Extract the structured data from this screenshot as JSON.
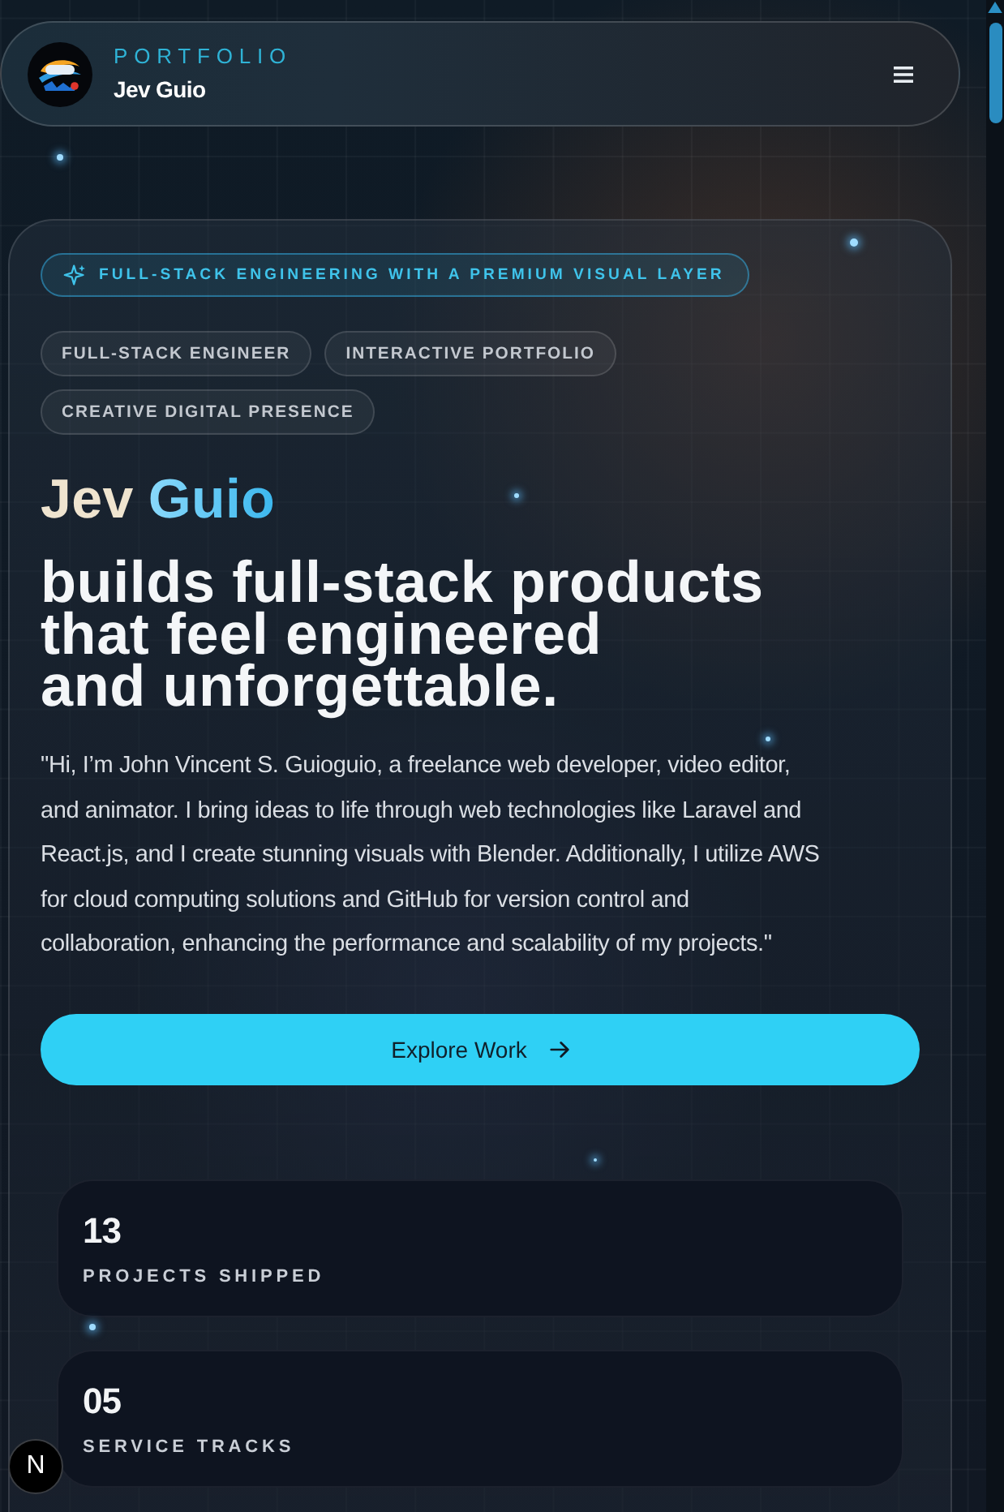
{
  "header": {
    "eyebrow": "PORTFOLIO",
    "title": "Jev Guio"
  },
  "hero": {
    "badge": "FULL-STACK ENGINEERING WITH A PREMIUM VISUAL LAYER",
    "chips": [
      "FULL-STACK ENGINEER",
      "INTERACTIVE PORTFOLIO",
      "CREATIVE DIGITAL PRESENCE"
    ],
    "name": [
      {
        "text": "Jev",
        "accent": false
      },
      {
        "text": "Guio",
        "accent": true
      }
    ],
    "headline": [
      "builds full-stack products",
      "that feel engineered",
      "and unforgettable."
    ],
    "intro": "\"Hi, I’m John Vincent S. Guioguio, a freelance web developer, video editor, and animator. I bring ideas to life through web technologies like Laravel and React.js, and I create stunning visuals with Blender. Additionally, I utilize AWS for cloud computing solutions and GitHub for version control and collaboration, enhancing the performance and scalability of my projects.\"",
    "cta": {
      "label": "Explore Work"
    }
  },
  "stats": [
    {
      "value": "13",
      "label": "PROJECTS SHIPPED"
    },
    {
      "value": "05",
      "label": "SERVICE TRACKS"
    }
  ],
  "dev_indicator": {
    "label": "N"
  }
}
